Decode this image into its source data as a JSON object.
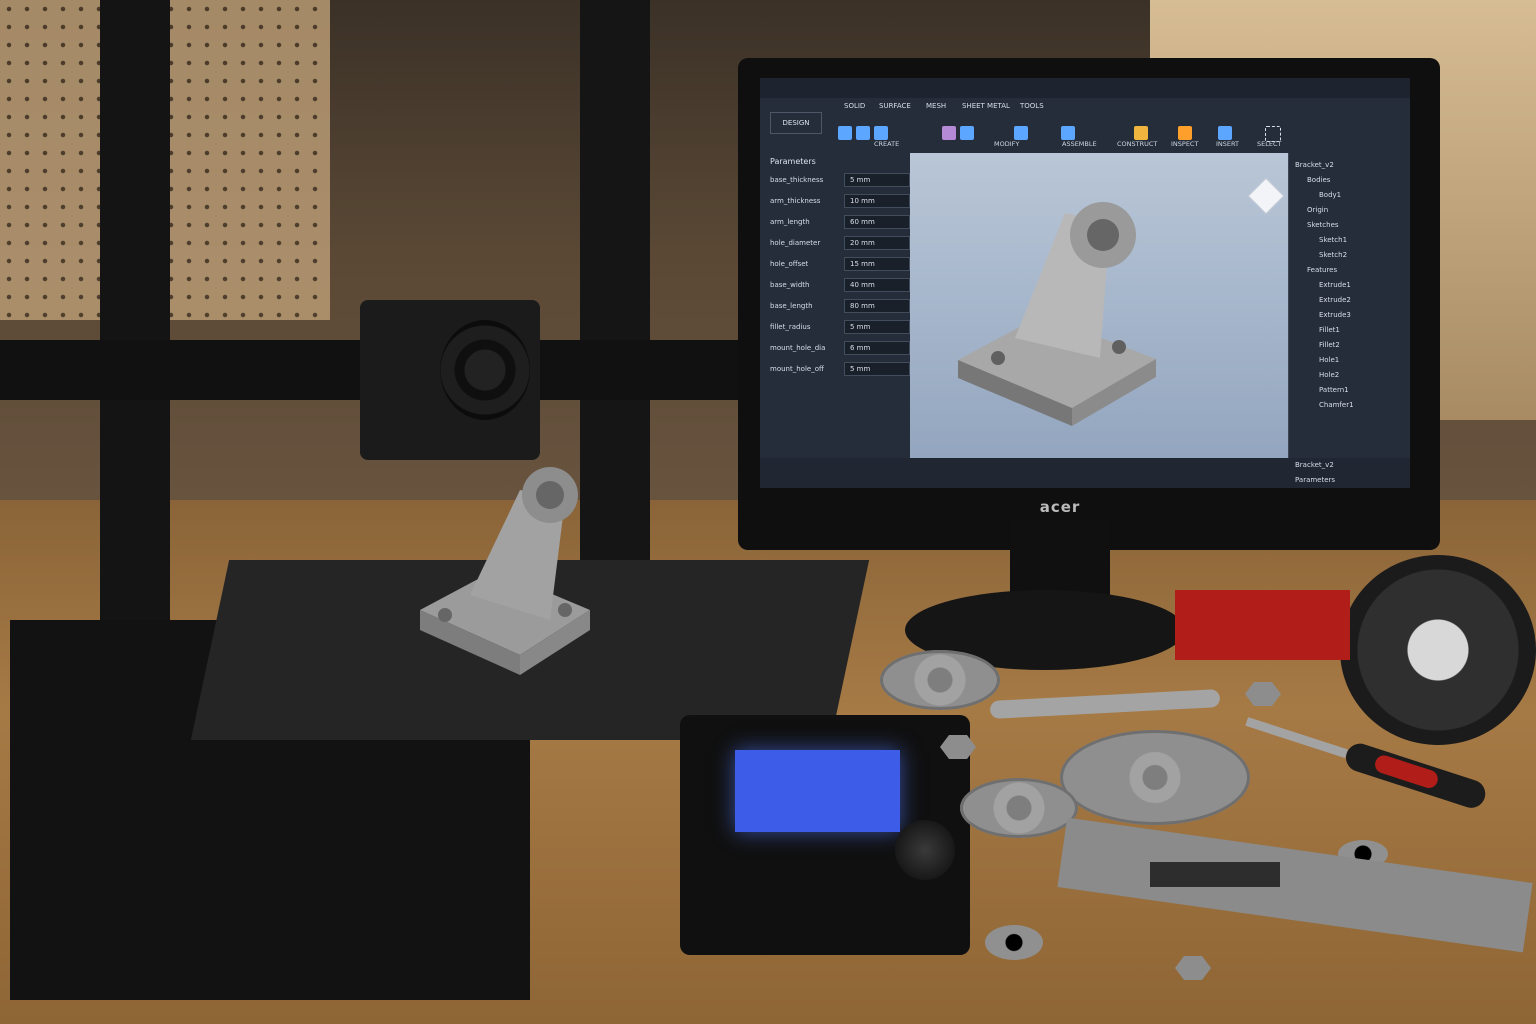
{
  "monitor": {
    "brand": "acer"
  },
  "cad": {
    "workspace": "DESIGN",
    "tabs": [
      "SOLID",
      "SURFACE",
      "MESH",
      "SHEET METAL",
      "TOOLS"
    ],
    "groups": [
      "CREATE",
      "MODIFY",
      "ASSEMBLE",
      "CONSTRUCT",
      "INSPECT",
      "INSERT",
      "SELECT"
    ],
    "parameters_title": "Parameters",
    "parameters": [
      {
        "name": "base_thickness",
        "value": "5 mm"
      },
      {
        "name": "arm_thickness",
        "value": "10 mm"
      },
      {
        "name": "arm_length",
        "value": "60 mm"
      },
      {
        "name": "hole_diameter",
        "value": "20 mm"
      },
      {
        "name": "hole_offset",
        "value": "15 mm"
      },
      {
        "name": "base_width",
        "value": "40 mm"
      },
      {
        "name": "base_length",
        "value": "80 mm"
      },
      {
        "name": "fillet_radius",
        "value": "5 mm"
      },
      {
        "name": "mount_hole_dia",
        "value": "6 mm"
      },
      {
        "name": "mount_hole_off",
        "value": "5 mm"
      }
    ],
    "browser": [
      {
        "label": "Bracket_v2",
        "indent": 0
      },
      {
        "label": "Bodies",
        "indent": 1
      },
      {
        "label": "Body1",
        "indent": 2
      },
      {
        "label": "Origin",
        "indent": 1
      },
      {
        "label": "Sketches",
        "indent": 1
      },
      {
        "label": "Sketch1",
        "indent": 2
      },
      {
        "label": "Sketch2",
        "indent": 2
      },
      {
        "label": "Features",
        "indent": 1
      },
      {
        "label": "Extrude1",
        "indent": 2
      },
      {
        "label": "Extrude2",
        "indent": 2
      },
      {
        "label": "Extrude3",
        "indent": 2
      },
      {
        "label": "Fillet1",
        "indent": 2
      },
      {
        "label": "Fillet2",
        "indent": 2
      },
      {
        "label": "Hole1",
        "indent": 2
      },
      {
        "label": "Hole2",
        "indent": 2
      },
      {
        "label": "Pattern1",
        "indent": 2
      },
      {
        "label": "Chamfer1",
        "indent": 2
      }
    ],
    "footer": [
      "Bracket_v2",
      "Parameters"
    ]
  },
  "colors": {
    "accent": "#5da6ff",
    "lcd": "#3d5de8",
    "tray": "#b11d18"
  }
}
